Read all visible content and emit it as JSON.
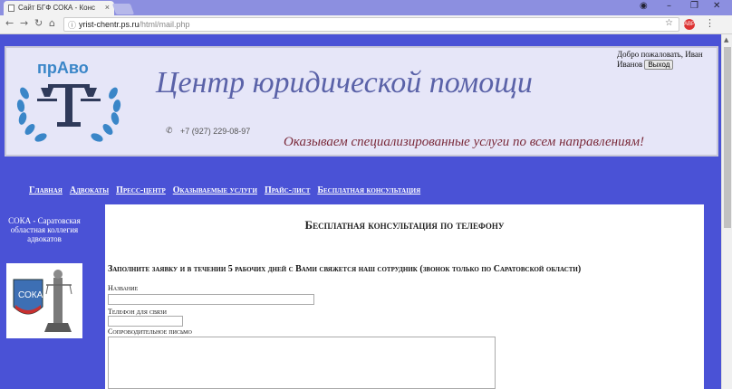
{
  "browser": {
    "tab_title": "Сайт БГФ СОКА - Конс",
    "url_host": "yrist-chentr.ps.ru",
    "url_path": "/html/mail.php",
    "extension_badge": "ABP"
  },
  "header": {
    "logo_text": "прАво",
    "site_title": "Центр юридической помощи",
    "phone": "+7 (927) 229-08-97",
    "slogan": "Оказываем специализированные услуги по всем направлениям!",
    "welcome": "Добро пожаловать, Иван Иванов",
    "logout_label": "Выход"
  },
  "nav": {
    "items": [
      "Главная",
      "Адвокаты",
      "Пресс-центр",
      "Оказываемые услуги",
      "Прайс-лист",
      "Бесплатная консультация"
    ]
  },
  "sidebar": {
    "title": "СОКА - Саратовская областная коллегия адвокатов",
    "badge_text": "СОКА"
  },
  "content": {
    "title": "Бесплатная консультация по телефону",
    "notice": "Заполните заявку и в течении 5 рабочих дней с Вами свяжется наш сотрудник (звонок только по Саратовской области)",
    "fields": {
      "name_label": "Название",
      "phone_label": "Телефон для связи",
      "letter_label": "Сопроводительное письмо"
    }
  }
}
